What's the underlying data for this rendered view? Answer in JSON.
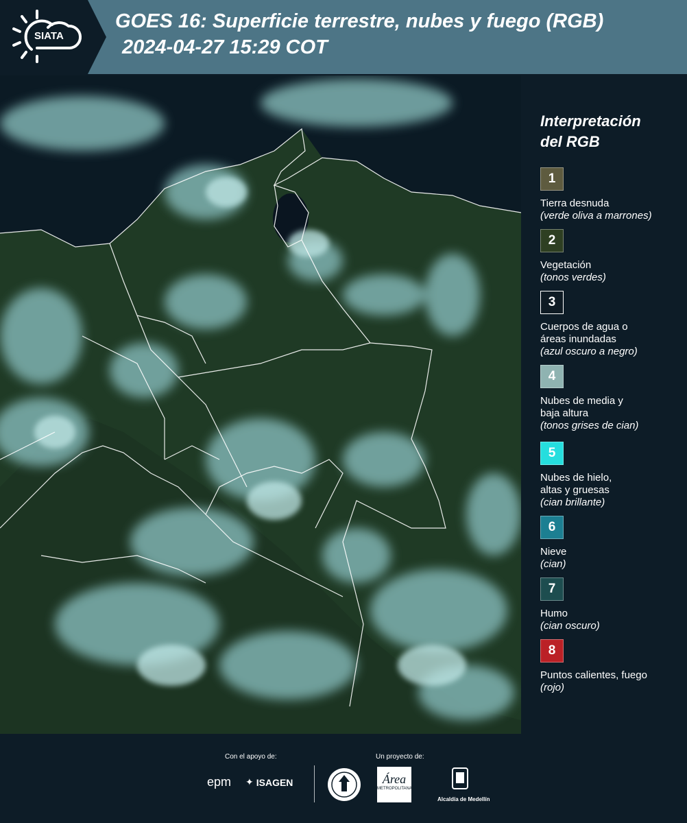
{
  "header": {
    "logo_text": "SIATA",
    "title_line1": "GOES 16: Superficie terrestre, nubes y fuego (RGB)",
    "title_line2": "2024-04-27 15:29 COT"
  },
  "legend": {
    "title_line1": "Interpretación",
    "title_line2": "del RGB",
    "items": [
      {
        "number": "1",
        "color": "#5e5b3f",
        "label1": "Tierra desnuda",
        "label2": "",
        "sub": "(verde oliva a marrones)"
      },
      {
        "number": "2",
        "color": "#2e3f22",
        "label1": "Vegetación",
        "label2": "",
        "sub": "(tonos verdes)"
      },
      {
        "number": "3",
        "color": "#0f1b24",
        "label1": "Cuerpos de agua o",
        "label2": "áreas inundadas",
        "sub": "(azul oscuro a negro)"
      },
      {
        "number": "4",
        "color": "#8fb3b1",
        "label1": "Nubes de media y",
        "label2": "baja altura",
        "sub": "(tonos grises de cian)"
      },
      {
        "number": "5",
        "color": "#25dede",
        "label1": "Nubes de hielo,",
        "label2": "altas y gruesas",
        "sub": "(cian brillante)"
      },
      {
        "number": "6",
        "color": "#1c7f92",
        "label1": "Nieve",
        "label2": "",
        "sub": "(cian)"
      },
      {
        "number": "7",
        "color": "#1d4d4f",
        "label1": "Humo",
        "label2": "",
        "sub": "(cian oscuro)"
      },
      {
        "number": "8",
        "color": "#bb2126",
        "label1": "Puntos calientes, fuego",
        "label2": "",
        "sub": "(rojo)"
      }
    ]
  },
  "footer": {
    "support_label": "Con el apoyo de:",
    "project_label": "Un proyecto de:",
    "epm": "epm",
    "isagen": "ISAGEN",
    "area_logo_text": "Área",
    "area_logo_sub": "METROPOLITANA",
    "alcaldia": "Alcaldía de Medellín"
  },
  "colors": {
    "header_band": "#4d7586",
    "header_dark": "#0d1c27",
    "background": "#0d1c27",
    "vegetation": "#1f3a25",
    "cloud": "#8fc7c7",
    "water": "#0a1520"
  }
}
